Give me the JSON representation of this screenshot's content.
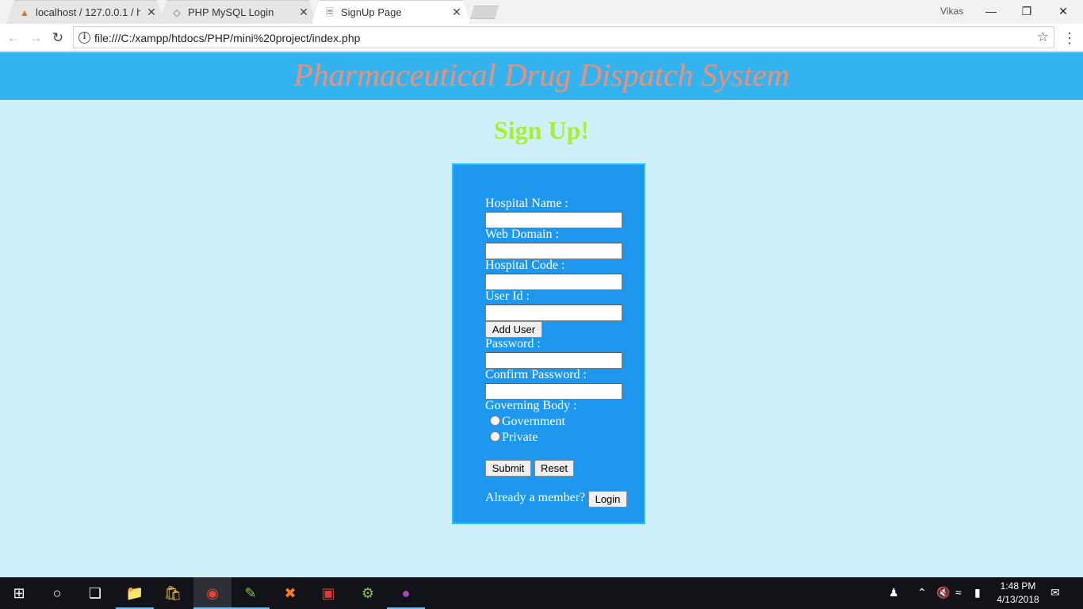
{
  "browser": {
    "tabs": [
      {
        "icon": "phpmyadmin-icon",
        "title": "localhost / 127.0.0.1 / ho",
        "active": false
      },
      {
        "icon": "php-icon",
        "title": "PHP MySQL Login",
        "active": false
      },
      {
        "icon": "page-icon",
        "title": "SignUp Page",
        "active": true
      }
    ],
    "profile_name": "Vikas",
    "url": "file:///C:/xampp/htdocs/PHP/mini%20project/index.php"
  },
  "page": {
    "banner_title": "Pharmaceutical Drug Dispatch System",
    "heading": "Sign Up!",
    "form": {
      "hospital_name_label": "Hospital Name :",
      "web_domain_label": "Web Domain :",
      "hospital_code_label": "Hospital Code :",
      "user_id_label": "User Id :",
      "add_user_button": "Add User",
      "password_label": "Password :",
      "confirm_password_label": "Confirm Password :",
      "governing_body_label": "Governing Body :",
      "options": [
        "Government",
        "Private"
      ],
      "submit_button": "Submit",
      "reset_button": "Reset",
      "already_member_text": "Already a member?",
      "login_button": "Login"
    }
  },
  "taskbar": {
    "time": "1:48 PM",
    "date": "4/13/2018"
  },
  "colors": {
    "banner_bg": "#34b4ef",
    "banner_text": "#ef8f77",
    "heading_text": "#a7f02c",
    "form_bg": "#1e98ef",
    "page_bg": "#cfeffb"
  }
}
